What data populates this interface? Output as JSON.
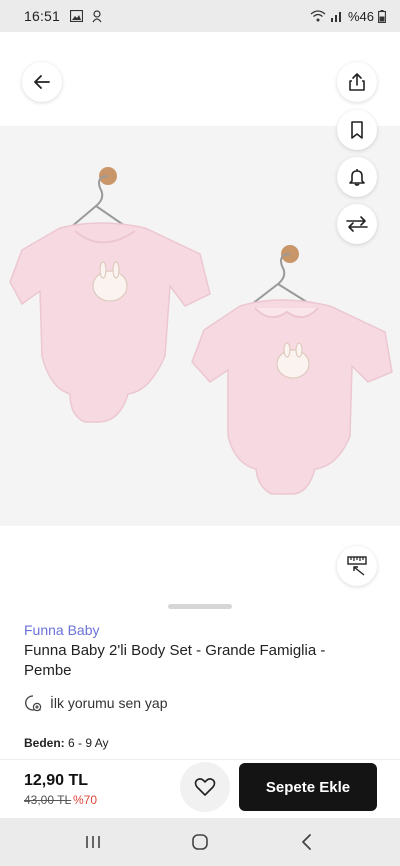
{
  "status_bar": {
    "time": "16:51",
    "battery_text": "%46"
  },
  "product": {
    "brand": "Funna Baby",
    "title": "Funna Baby 2'li Body Set - Grande Famiglia - Pembe",
    "review_prompt": "İlk yorumu sen yap",
    "size_label": "Beden:",
    "size_value": "6 - 9 Ay"
  },
  "purchase": {
    "price": "12,90 TL",
    "old_price": "43,00 TL",
    "discount": "%70",
    "cart_button_label": "Sepete Ekle"
  },
  "icons": {
    "back": "arrow-left-icon",
    "share": "share-icon",
    "bookmark": "bookmark-icon",
    "bell": "bell-icon",
    "compare": "compare-arrows-icon",
    "size_guide": "ruler-icon",
    "favorite": "heart-icon",
    "review": "comment-add-icon"
  },
  "colors": {
    "brand_text": "#6b72d6",
    "discount": "#e0443a",
    "cart_button": "#141414",
    "bodysuit": "#f7d9e1"
  }
}
